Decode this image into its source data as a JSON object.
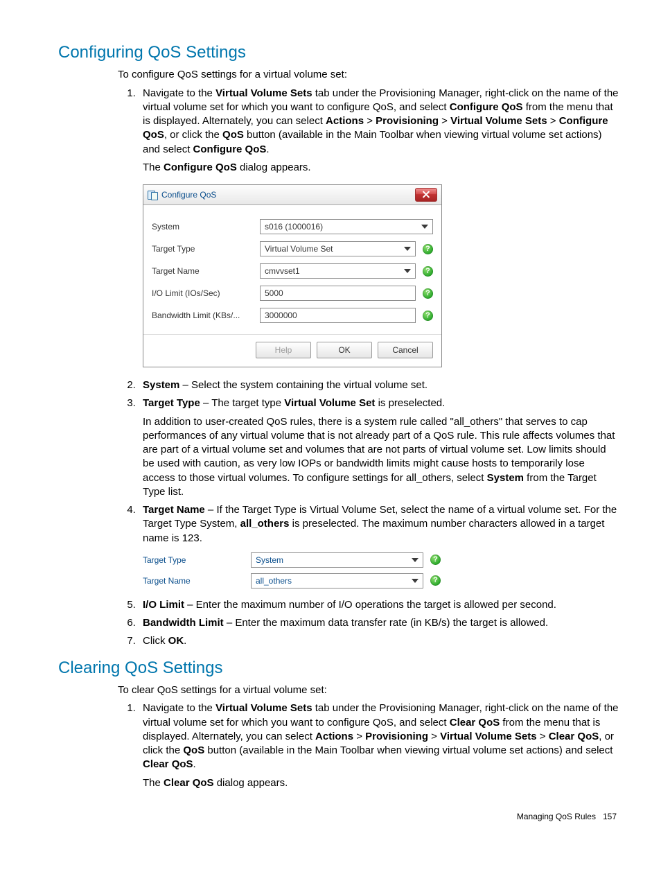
{
  "section1": {
    "heading": "Configuring QoS Settings",
    "intro": "To configure QoS settings for a virtual volume set:",
    "steps": {
      "s1": {
        "pre": "Navigate to the ",
        "b1": "Virtual Volume Sets",
        "mid1": " tab under the Provisioning Manager, right-click on the name of the virtual volume set for which you want to configure QoS, and select ",
        "b2": "Configure QoS",
        "mid2": " from the menu that is displayed. Alternately, you can select ",
        "b3": "Actions",
        "gt1": " > ",
        "b4": "Provisioning",
        "gt2": " > ",
        "b5": "Virtual Volume Sets",
        "gt3": " > ",
        "b6": "Configure QoS",
        "mid3": ", or click the ",
        "b7": "QoS",
        "mid4": " button (available in the Main Toolbar when viewing virtual volume set actions) and select ",
        "b8": "Configure QoS",
        "mid5": ".",
        "after_pre": "The ",
        "after_b": "Configure QoS",
        "after_post": " dialog appears."
      },
      "s2": {
        "b": "System",
        "txt": " – Select the system containing the virtual volume set."
      },
      "s3": {
        "b": "Target Type",
        "t1": " – The target type ",
        "b2": "Virtual Volume Set",
        "t2": " is preselected.",
        "para_pre": "In addition to user-created QoS rules, there is a system rule called \"all_others\" that serves to cap performances of any virtual volume that is not already part of a QoS rule. This rule affects volumes that are part of a virtual volume set and volumes that are not parts of virtual volume set. Low limits should be used with caution, as very low IOPs or bandwidth limits might cause hosts to temporarily lose access to those virtual volumes. To configure settings for all_others, select ",
        "para_b": "System",
        "para_post": " from the Target Type list."
      },
      "s4": {
        "b": "Target Name",
        "t1": " – If the Target Type is Virtual Volume Set, select the name of a virtual volume set. For the Target Type System, ",
        "b2": "all_others",
        "t2": " is preselected. The maximum number characters allowed in a target name is 123."
      },
      "s5": {
        "b": "I/O Limit",
        "txt": " – Enter the maximum number of I/O operations the target is allowed per second."
      },
      "s6": {
        "b": "Bandwidth Limit",
        "txt": " – Enter the maximum data transfer rate (in KB/s) the target is allowed."
      },
      "s7": {
        "t1": "Click ",
        "b": "OK",
        "t2": "."
      }
    }
  },
  "dialog": {
    "title": "Configure QoS",
    "labels": {
      "system": "System",
      "ttype": "Target Type",
      "tname": "Target Name",
      "iolimit": "I/O Limit (IOs/Sec)",
      "bwlimit": "Bandwidth Limit (KBs/..."
    },
    "values": {
      "system": "s016 (1000016)",
      "ttype": "Virtual Volume Set",
      "tname": "cmvvset1",
      "iolimit": "5000",
      "bwlimit": "3000000"
    },
    "buttons": {
      "help": "Help",
      "ok": "OK",
      "cancel": "Cancel"
    }
  },
  "panel2": {
    "labels": {
      "ttype": "Target Type",
      "tname": "Target Name"
    },
    "values": {
      "ttype": "System",
      "tname": "all_others"
    }
  },
  "section2": {
    "heading": "Clearing QoS Settings",
    "intro": "To clear QoS settings for a virtual volume set:",
    "steps": {
      "s1": {
        "pre": "Navigate to the ",
        "b1": "Virtual Volume Sets",
        "mid1": " tab under the Provisioning Manager, right-click on the name of the virtual volume set for which you want to configure QoS, and select ",
        "b2": "Clear QoS",
        "mid2": " from the menu that is displayed. Alternately, you can select ",
        "b3": "Actions",
        "gt1": " > ",
        "b4": "Provisioning",
        "gt2": " > ",
        "b5": "Virtual Volume Sets",
        "gt3": " > ",
        "b6": "Clear QoS",
        "mid3": ", or click the ",
        "b7": "QoS",
        "mid4": " button (available in the Main Toolbar when viewing virtual volume set actions) and select ",
        "b8": "Clear QoS",
        "mid5": ".",
        "after_pre": "The ",
        "after_b": "Clear QoS",
        "after_post": " dialog appears."
      }
    }
  },
  "footer": {
    "text": "Managing QoS Rules",
    "page": "157"
  }
}
